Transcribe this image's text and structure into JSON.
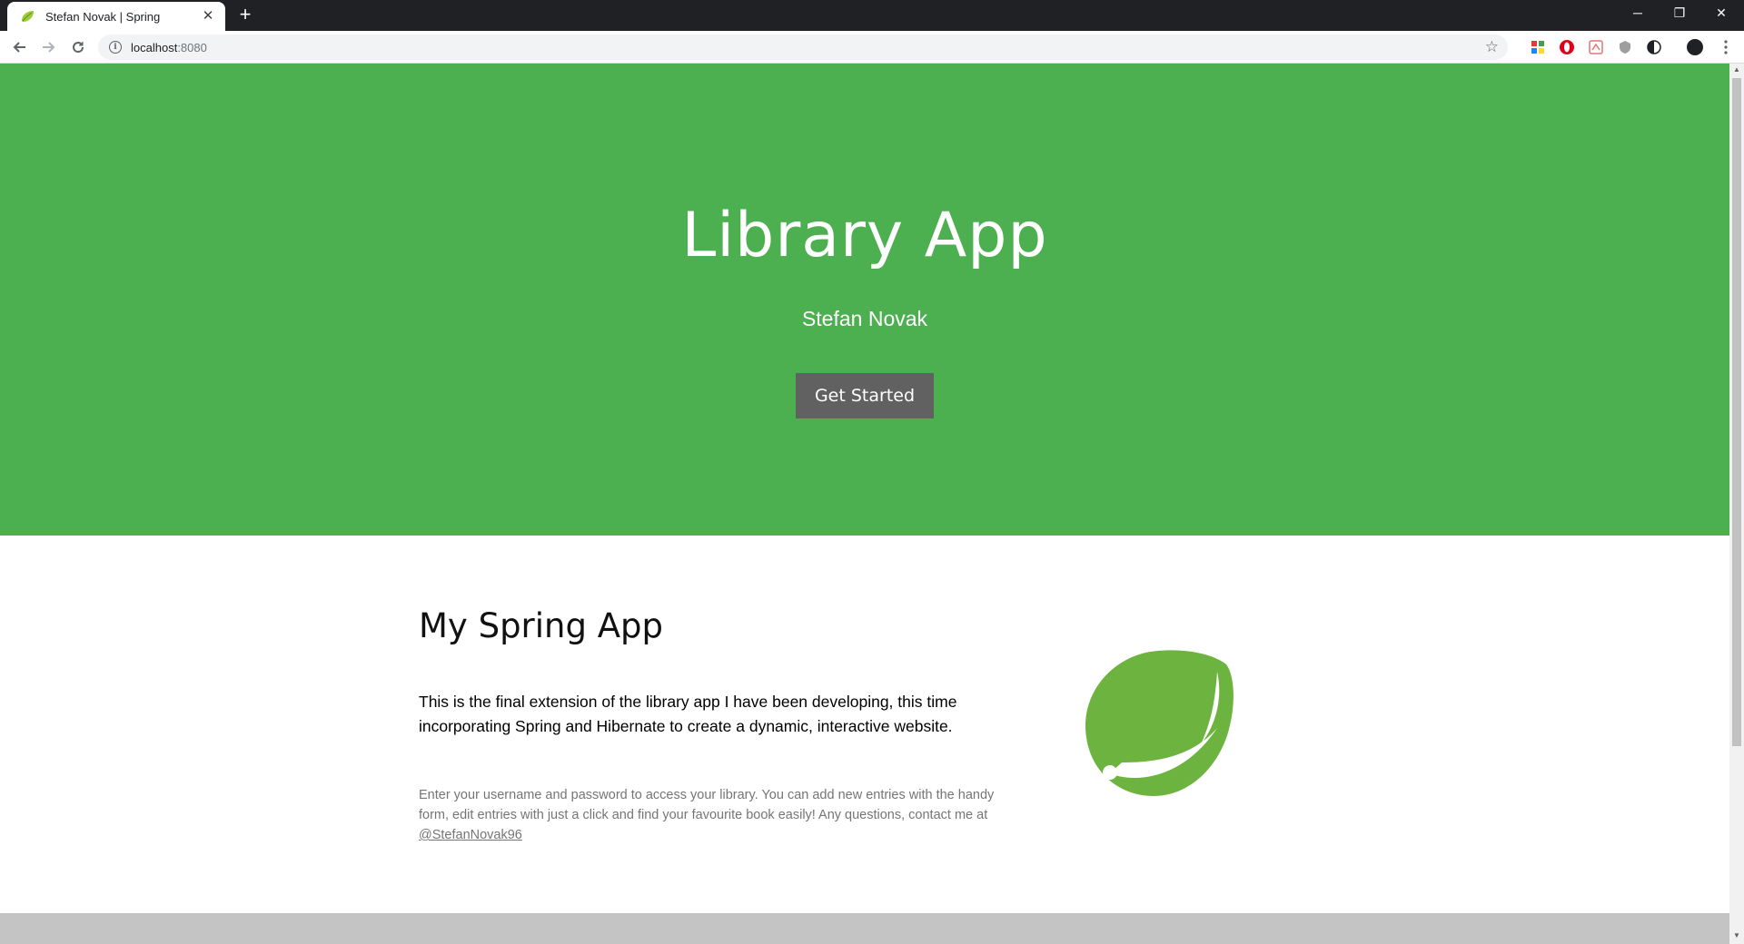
{
  "browser": {
    "tab_title": "Stefan Novak | Spring",
    "tab_close": "✕",
    "new_tab": "+",
    "url_host": "localhost",
    "url_port": ":8080",
    "window_controls": {
      "minimize": "─",
      "restore": "❐",
      "close": "✕"
    },
    "extensions": [
      "extension-icon",
      "opera-icon",
      "pdf-icon",
      "shield-icon",
      "contrast-icon",
      "avatar-icon"
    ]
  },
  "hero": {
    "title": "Library App",
    "subtitle": "Stefan Novak",
    "button_label": "Get Started",
    "background": "#4caf50"
  },
  "about": {
    "heading": "My Spring App",
    "lead": "This is the final extension of the library app I have been developing, this time incorporating Spring and Hibernate to create a dynamic, interactive website.",
    "body": "Enter your username and password to access your library. You can add new entries with the handy form, edit entries with just a click and find your favourite book easily! Any questions, contact me at ",
    "contact_link": "@StefanNovak96",
    "logo": "spring-leaf-logo",
    "logo_color": "#6db33f"
  }
}
